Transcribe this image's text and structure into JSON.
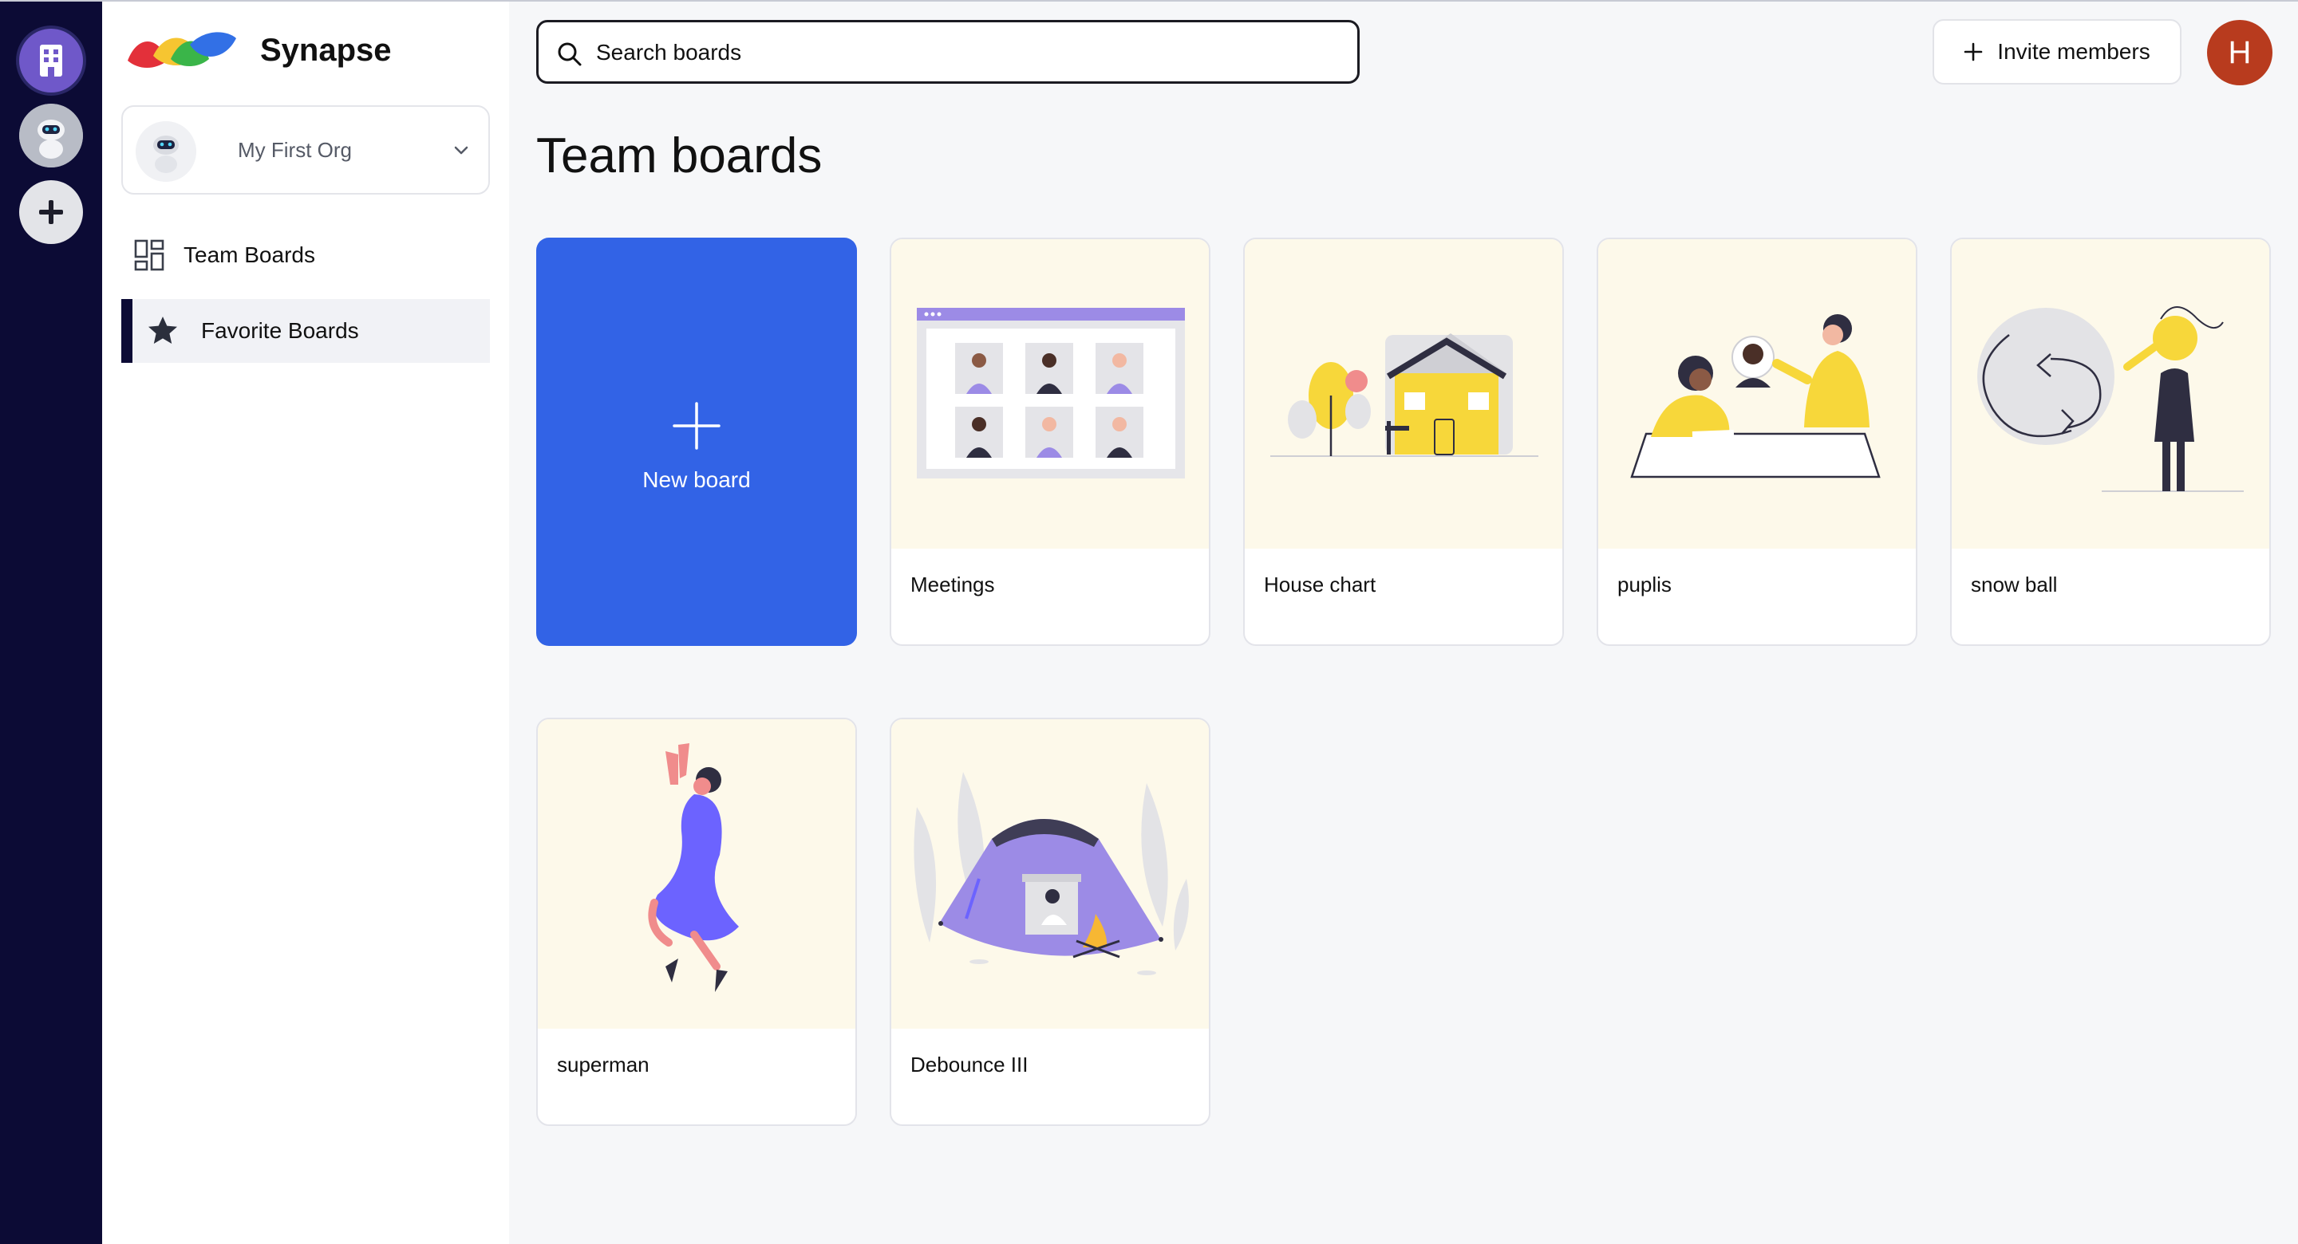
{
  "app": {
    "name": "Synapse"
  },
  "rail": {
    "add_label": "+"
  },
  "org": {
    "name": "My First Org"
  },
  "sidebar": {
    "items": [
      {
        "label": "Team Boards",
        "icon": "dashboard-icon"
      },
      {
        "label": "Favorite Boards",
        "icon": "star-icon",
        "active": true
      }
    ]
  },
  "search": {
    "placeholder": "Search boards"
  },
  "header": {
    "invite_label": "Invite members",
    "user_initial": "H"
  },
  "page": {
    "title": "Team boards"
  },
  "boards": {
    "new_label": "New board",
    "items": [
      {
        "name": "Meetings",
        "illustration": "video-call"
      },
      {
        "name": "House chart",
        "illustration": "house"
      },
      {
        "name": "puplis",
        "illustration": "team-table"
      },
      {
        "name": "snow ball",
        "illustration": "snowball"
      },
      {
        "name": "superman",
        "illustration": "flying-woman"
      },
      {
        "name": "Debounce III",
        "illustration": "tent-campfire"
      }
    ]
  },
  "colors": {
    "accent": "#3263e6",
    "rail": "#0c0b35",
    "avatar": "#b83b1e",
    "thumb_bg": "#fdf9ea"
  }
}
